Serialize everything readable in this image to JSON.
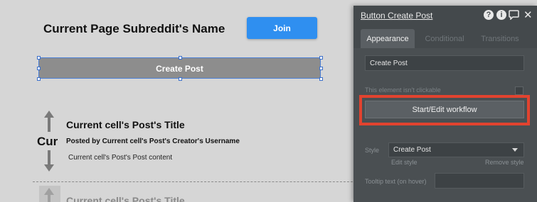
{
  "canvas": {
    "page_title": "Current Page Subreddit's Name",
    "join_button": "Join",
    "create_post_button": "Create Post",
    "repeating_cell": {
      "title": "Current cell's Post's Title",
      "creator": "Posted by Current cell's Post's Creator's Username",
      "content": "Current cell's Post's Post content",
      "vote_text": "Cur"
    },
    "next_cell_title": "Current cell's Post's Title"
  },
  "panel": {
    "title": "Button Create Post",
    "header_icons": [
      "help-icon",
      "info-icon",
      "comment-icon",
      "close-icon"
    ],
    "tabs": [
      {
        "label": "Appearance",
        "active": true
      },
      {
        "label": "Conditional",
        "active": false
      },
      {
        "label": "Transitions",
        "active": false
      }
    ],
    "text_field_value": "Create Post",
    "not_clickable_label": "This element isn't clickable",
    "workflow_button": "Start/Edit workflow",
    "style_label": "Style",
    "style_value": "Create Post",
    "edit_style_link": "Edit style",
    "remove_style_link": "Remove style",
    "tooltip_label": "Tooltip text (on hover)",
    "tooltip_value": ""
  },
  "colors": {
    "join_button": "#2f8ff0",
    "create_post_button": "#8d8d8d",
    "panel_bg": "#4a4f52",
    "highlight": "#e2432f",
    "selection": "#4b7fd6"
  }
}
